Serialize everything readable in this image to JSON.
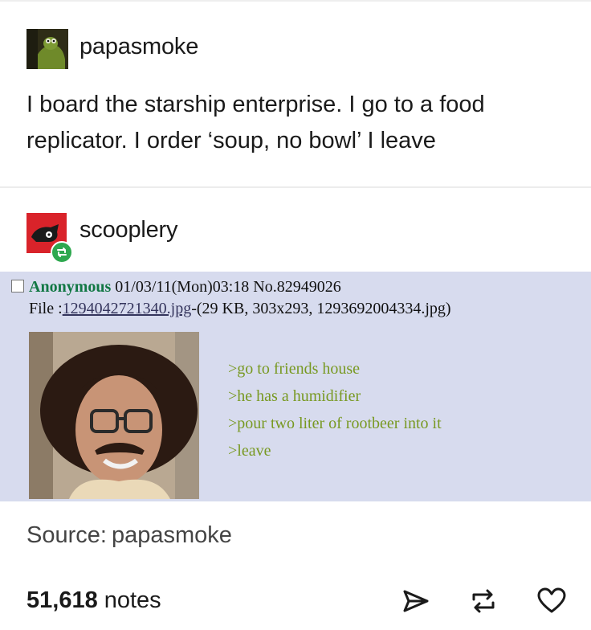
{
  "post": {
    "author": "papasmoke",
    "text": "I board the starship enterprise. I go to a food replicator. I order ‘soup, no bowl’ I leave"
  },
  "reblog": {
    "author": "scooplery",
    "badge_icon": "reblog-icon",
    "accent": "#2ea84f",
    "avatar_color": "#d9232a"
  },
  "chan_post": {
    "name": "Anonymous",
    "datetime": "01/03/11(Mon)03:18",
    "number": "No.82949026",
    "file_label": "File :",
    "file_link": "1294042721340.jpg",
    "file_info": "-(29 KB, 303x293, 1293692004334.jpg)",
    "greentext": [
      ">go to friends house",
      ">he has a humidifier",
      ">pour two liter of rootbeer into it",
      ">leave"
    ],
    "bg": "#d7dbee",
    "greentext_color": "#789922",
    "name_color": "#117743"
  },
  "source": {
    "label": "Source:",
    "name": "papasmoke"
  },
  "footer": {
    "notes_count": "51,618",
    "notes_label": "notes",
    "icons": [
      "share-icon",
      "reblog-icon",
      "heart-icon"
    ]
  }
}
